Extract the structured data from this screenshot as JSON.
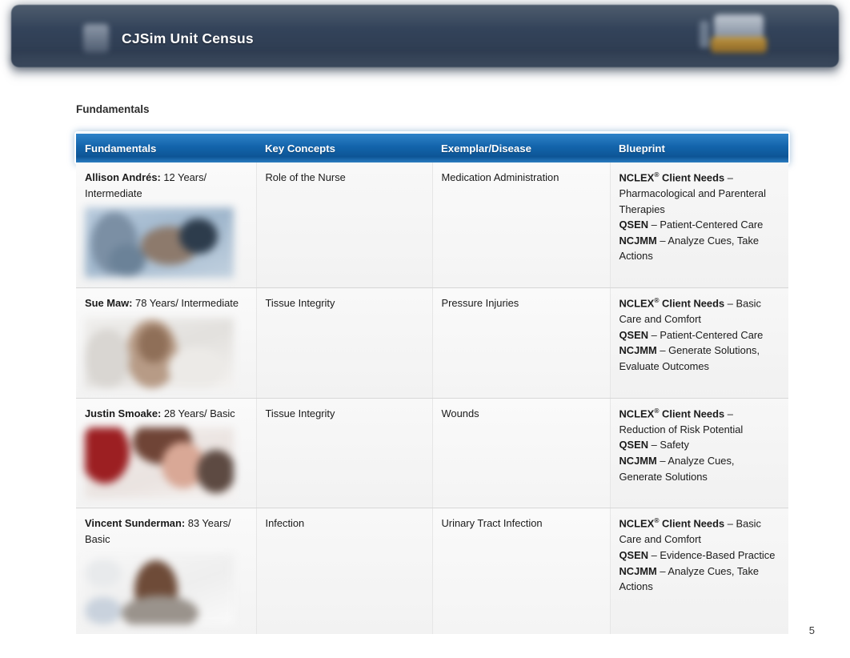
{
  "banner": {
    "title": "CJSim Unit Census",
    "logo_icon": "publisher-logo-icon",
    "badge_icon": "app-badge-icon"
  },
  "section": {
    "title": "Fundamentals"
  },
  "table": {
    "columns": [
      "Fundamentals",
      "Key Concepts",
      "Exemplar/Disease",
      "Blueprint"
    ],
    "rows": [
      {
        "patient_name": "Allison Andrés:",
        "patient_detail": " 12 Years/ Intermediate",
        "photo_icon": "patient-photo-allison-andres",
        "key_concepts": "Role of the Nurse",
        "exemplar": "Medication Administration",
        "blueprint": [
          {
            "key": "NCLEX",
            "key_sup": "®",
            "key_rest": " Client Needs",
            "value": " – Pharmacological and Parenteral Therapies"
          },
          {
            "key": "QSEN",
            "key_sup": "",
            "key_rest": "",
            "value": " – Patient-Centered Care"
          },
          {
            "key": "NCJMM",
            "key_sup": "",
            "key_rest": "",
            "value": " – Analyze Cues, Take Actions"
          }
        ]
      },
      {
        "patient_name": "Sue Maw:",
        "patient_detail": " 78 Years/ Intermediate",
        "photo_icon": "patient-photo-sue-maw",
        "key_concepts": "Tissue Integrity",
        "exemplar": "Pressure Injuries",
        "blueprint": [
          {
            "key": "NCLEX",
            "key_sup": "®",
            "key_rest": " Client Needs",
            "value": " – Basic Care and Comfort"
          },
          {
            "key": "QSEN",
            "key_sup": "",
            "key_rest": "",
            "value": " – Patient-Centered Care"
          },
          {
            "key": "NCJMM",
            "key_sup": "",
            "key_rest": "",
            "value": " – Generate Solutions, Evaluate Outcomes"
          }
        ]
      },
      {
        "patient_name": "Justin Smoake:",
        "patient_detail": " 28 Years/ Basic",
        "photo_icon": "patient-photo-justin-smoake",
        "key_concepts": "Tissue Integrity",
        "exemplar": "Wounds",
        "blueprint": [
          {
            "key": "NCLEX",
            "key_sup": "®",
            "key_rest": " Client Needs",
            "value": " – Reduction of Risk Potential"
          },
          {
            "key": "QSEN",
            "key_sup": "",
            "key_rest": "",
            "value": " – Safety"
          },
          {
            "key": "NCJMM",
            "key_sup": "",
            "key_rest": "",
            "value": " – Analyze Cues, Generate Solutions"
          }
        ]
      },
      {
        "patient_name": "Vincent Sunderman:",
        "patient_detail": " 83 Years/ Basic",
        "photo_icon": "patient-photo-vincent-sunderman",
        "key_concepts": "Infection",
        "exemplar": "Urinary Tract Infection",
        "blueprint": [
          {
            "key": "NCLEX",
            "key_sup": "®",
            "key_rest": " Client Needs",
            "value": " – Basic Care and Comfort"
          },
          {
            "key": "QSEN",
            "key_sup": "",
            "key_rest": "",
            "value": " – Evidence-Based Practice"
          },
          {
            "key": "NCJMM",
            "key_sup": "",
            "key_rest": "",
            "value": " – Analyze Cues, Take Actions"
          }
        ]
      }
    ]
  },
  "footer": {
    "page_number": "5"
  },
  "colors": {
    "banner_bg": "#33435a",
    "table_header_blue": "#1364ab",
    "row_bg": "#f6f6f6",
    "text": "#1b1b1b"
  }
}
